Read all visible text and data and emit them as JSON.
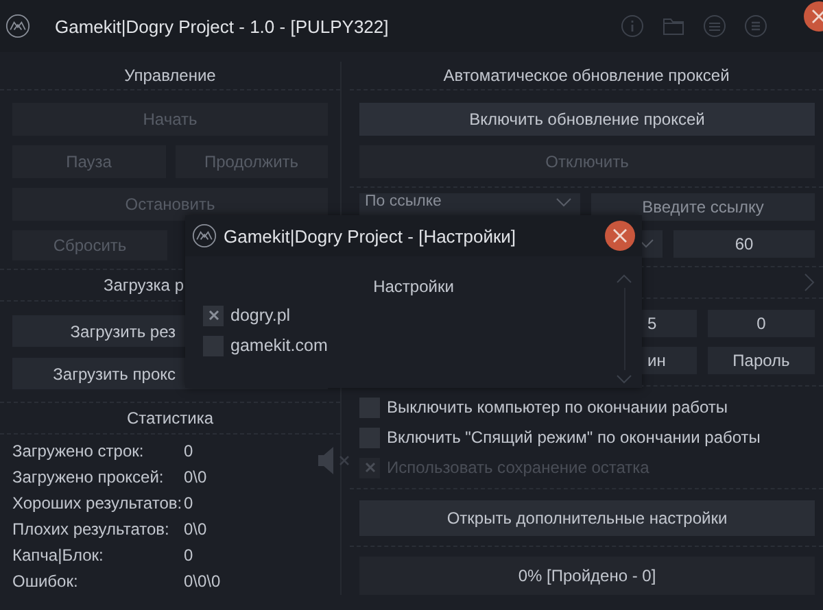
{
  "window": {
    "title": "Gamekit|Dogry Project - 1.0 - [PULPY322]"
  },
  "control": {
    "title": "Управление",
    "buttons": [
      {
        "label": "Начать",
        "disabled": true
      },
      {
        "label": "Пауза",
        "disabled": true
      },
      {
        "label": "Продолжить",
        "disabled": true
      },
      {
        "label": "Остановить",
        "disabled": true
      },
      {
        "label": "Сбросить",
        "disabled": true
      }
    ]
  },
  "loading": {
    "title": "Загрузка р",
    "buttons": [
      {
        "label": "Загрузить рез",
        "disabled": false
      },
      {
        "label": "Загрузить прокс",
        "disabled": false
      }
    ]
  },
  "statistics": {
    "title": "Статистика",
    "muted": true,
    "rows": [
      {
        "label": "Загружено строк:",
        "value": "0"
      },
      {
        "label": "Загружено проксей:",
        "value": "0\\0"
      },
      {
        "label": "Хороших результатов:",
        "value": "0"
      },
      {
        "label": "Плохих результатов:",
        "value": "0\\0"
      },
      {
        "label": "Капча|Блок:",
        "value": "0"
      },
      {
        "label": "Ошибок:",
        "value": "0\\0\\0"
      }
    ]
  },
  "proxy_update": {
    "title": "Автоматическое обновление проксей",
    "buttons": [
      {
        "label": "Включить обновление проксей",
        "disabled": false
      },
      {
        "label": "Отключить",
        "disabled": true
      }
    ],
    "source_dropdown": "По ссылке",
    "url_field": {
      "placeholder": "Введите ссылку"
    },
    "interval_field": "60"
  },
  "fields": [
    {
      "value": "5"
    },
    {
      "value": "0"
    }
  ],
  "login_buttons": [
    {
      "label": "ин"
    },
    {
      "label": "Пароль"
    }
  ],
  "options": [
    {
      "label": "Выключить компьютер по окончании работы",
      "checked": false,
      "disabled": false
    },
    {
      "label": "Включить \"Спящий режим\" по окончании работы",
      "checked": false,
      "disabled": false
    },
    {
      "label": "Использовать сохранение остатка",
      "checked": true,
      "disabled": true
    }
  ],
  "more_settings_button": "Открыть дополнительные настройки",
  "progress": {
    "level": 0,
    "text": "0% [Пройдено - 0]"
  },
  "dialog": {
    "title": "Gamekit|Dogry Project - [Настройки]",
    "heading": "Настройки",
    "items": [
      {
        "label": "dogry.pl",
        "checked": true
      },
      {
        "label": "gamekit.com",
        "checked": false
      }
    ]
  }
}
